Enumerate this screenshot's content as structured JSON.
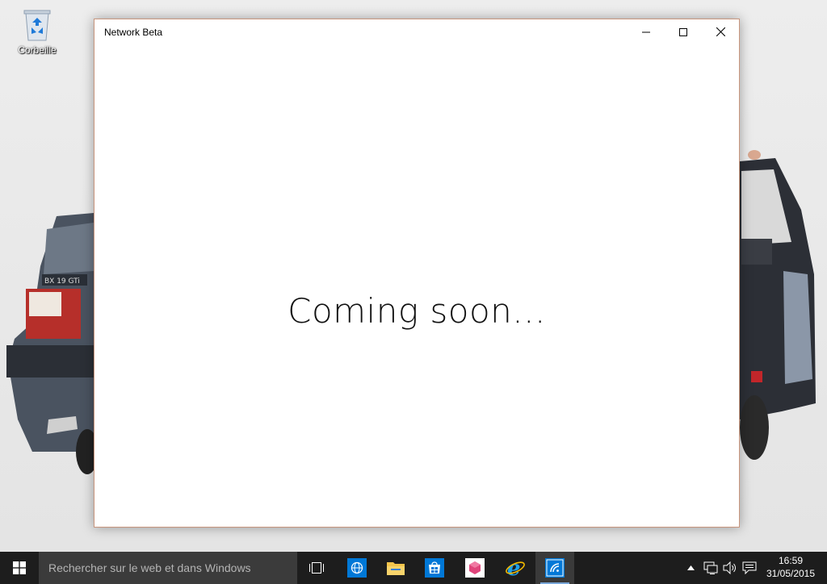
{
  "desktop": {
    "icons": [
      {
        "label": "Corbeille",
        "icon": "recycle-bin-icon"
      }
    ]
  },
  "window": {
    "title": "Network Beta",
    "message": "Coming soon...",
    "controls": [
      "minimize-icon",
      "maximize-icon",
      "close-icon"
    ]
  },
  "taskbar": {
    "search_placeholder": "Rechercher sur le web et dans Windows",
    "apps": [
      {
        "name": "task-view",
        "icon": "task-view-icon"
      },
      {
        "name": "network-app",
        "icon": "globe-icon"
      },
      {
        "name": "file-explorer",
        "icon": "folder-icon"
      },
      {
        "name": "store",
        "icon": "store-icon"
      },
      {
        "name": "app",
        "icon": "package-icon"
      },
      {
        "name": "internet-explorer",
        "icon": "ie-icon"
      },
      {
        "name": "network-beta",
        "icon": "wifi-icon"
      }
    ],
    "clock": {
      "time": "16:59",
      "date": "31/05/2015"
    }
  },
  "colors": {
    "taskbar": "#1d1d1d",
    "search": "#3b3b3b",
    "window_border": "#c8967e",
    "accent": "#0078d7"
  }
}
